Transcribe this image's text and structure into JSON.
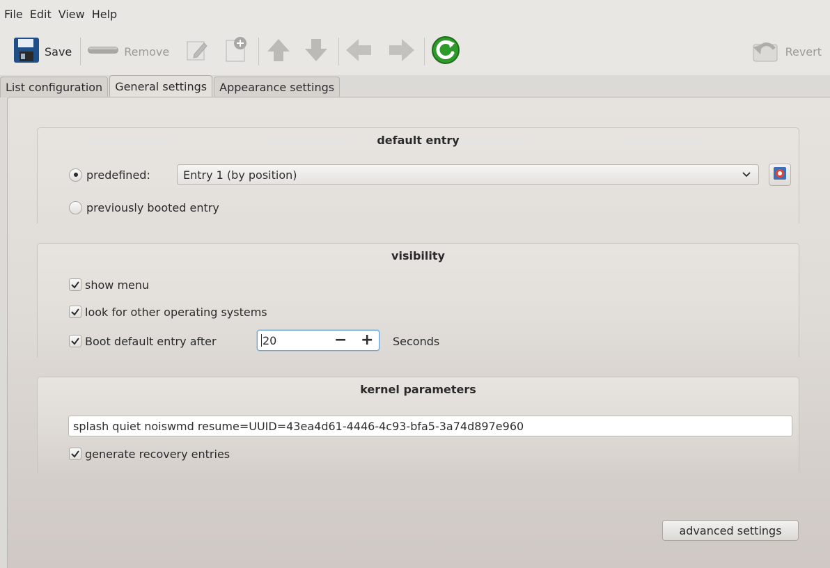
{
  "menubar": {
    "items": [
      "File",
      "Edit",
      "View",
      "Help"
    ]
  },
  "toolbar": {
    "save_label": "Save",
    "remove_label": "Remove",
    "revert_label": "Revert",
    "icons": [
      "save-icon",
      "remove-icon",
      "edit-icon",
      "add-entry-icon",
      "move-up-icon",
      "move-down-icon",
      "back-icon",
      "forward-icon",
      "reload-icon",
      "revert-icon"
    ]
  },
  "tabs": [
    {
      "label": "List configuration",
      "active": false
    },
    {
      "label": "General settings",
      "active": true
    },
    {
      "label": "Appearance settings",
      "active": false
    }
  ],
  "default_entry": {
    "title": "default entry",
    "predefined_label": "predefined:",
    "predefined_selected": true,
    "predefined_value": "Entry 1 (by position)",
    "previously_booted_label": "previously booted entry",
    "previously_booted_selected": false
  },
  "visibility": {
    "title": "visibility",
    "show_menu_label": "show menu",
    "show_menu_checked": true,
    "look_other_os_label": "look for other operating systems",
    "look_other_os_checked": true,
    "boot_default_label": "Boot default entry after",
    "boot_default_checked": true,
    "timeout_value": "20",
    "timeout_unit": "Seconds",
    "minus": "−",
    "plus": "+"
  },
  "kernel": {
    "title": "kernel parameters",
    "parameters_value": "splash quiet noiswmd resume=UUID=43ea4d61-4446-4c93-bfa5-3a74d897e960",
    "recovery_label": "generate recovery entries",
    "recovery_checked": true
  },
  "advanced_label": "advanced settings",
  "colors": {
    "reload_green": "#2e9a2a",
    "focus_blue": "#6aa6d8",
    "save_blue": "#1f4f86"
  }
}
